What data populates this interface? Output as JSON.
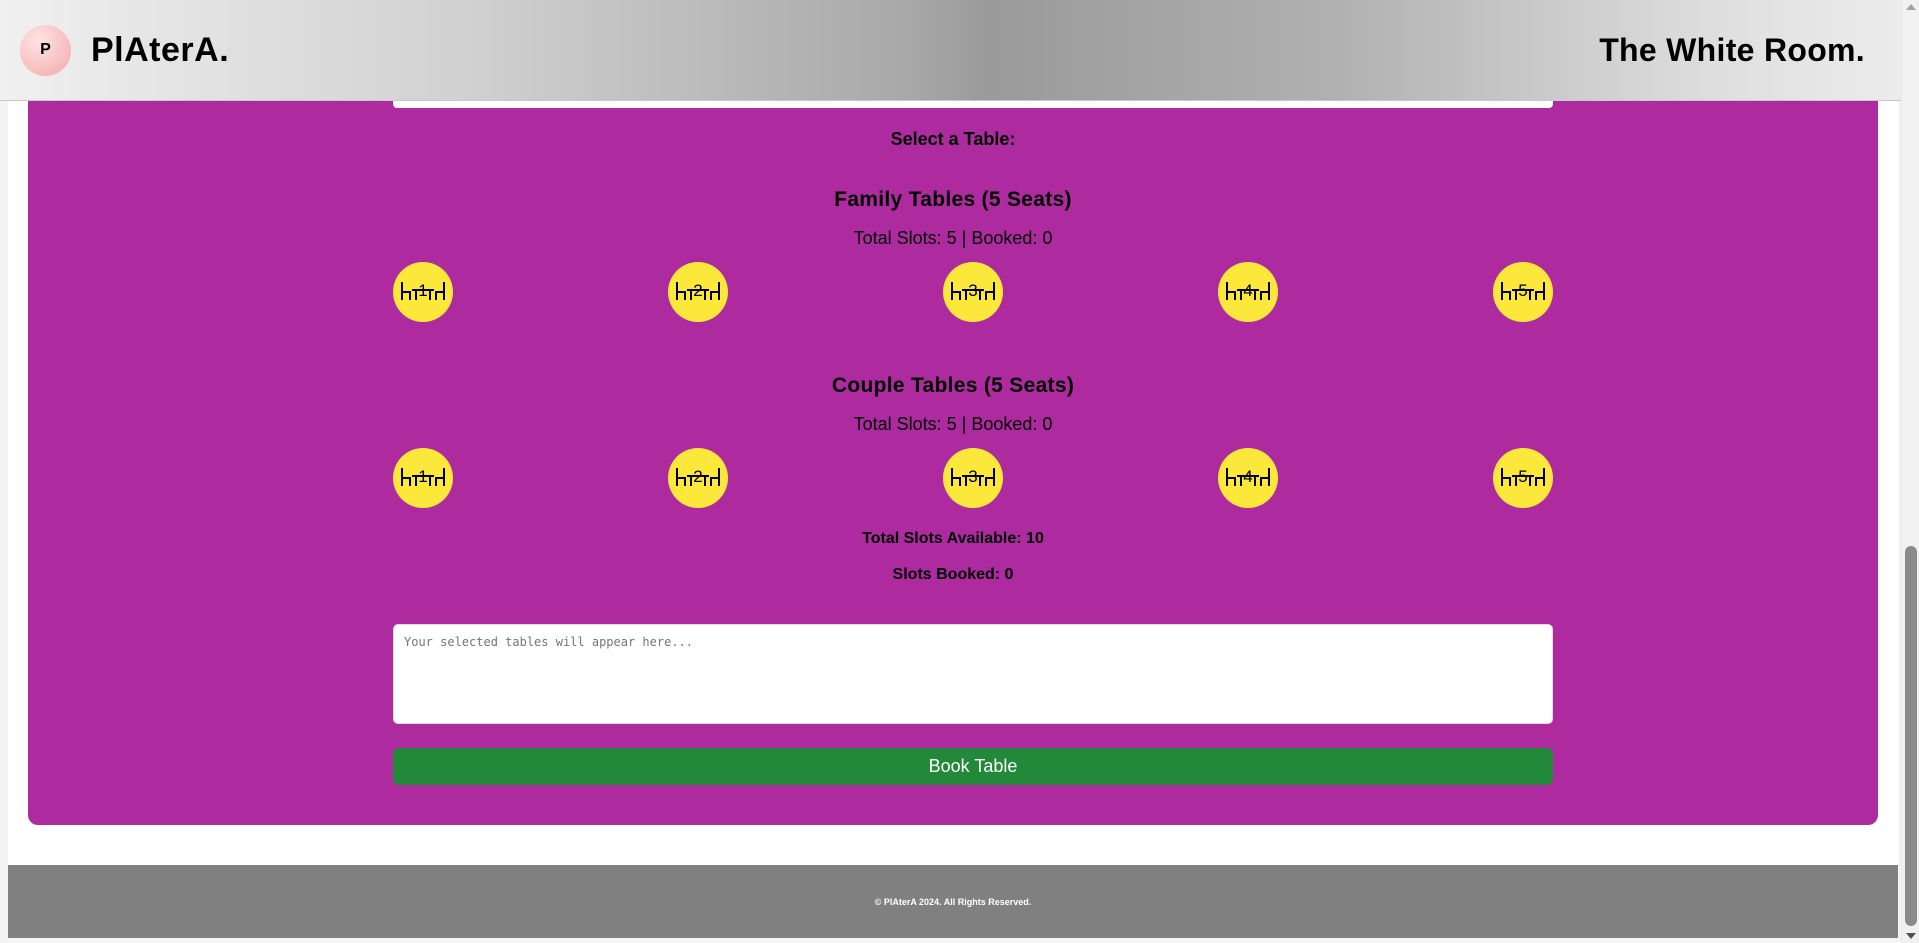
{
  "header": {
    "logo_letter": "P",
    "brand": "PlAterA.",
    "venue": "The White Room."
  },
  "booking": {
    "select_label": "Select a Table:",
    "family": {
      "title": "Family Tables (5 Seats)",
      "stats": "Total Slots: 5 | Booked: 0",
      "tables": [
        "1",
        "2",
        "3",
        "4",
        "5"
      ]
    },
    "couple": {
      "title": "Couple Tables (5 Seats)",
      "stats": "Total Slots: 5 | Booked: 0",
      "tables": [
        "1",
        "2",
        "3",
        "4",
        "5"
      ]
    },
    "total_available": "Total Slots Available: 10",
    "slots_booked": "Slots Booked: 0",
    "selected_placeholder": "Your selected tables will appear here...",
    "book_button": "Book Table"
  },
  "footer": {
    "text": "© PlAterA 2024. All Rights Reserved."
  },
  "colors": {
    "panel": "#ad2b9f",
    "table": "#fce83a",
    "book_button": "#22883a",
    "footer": "#808080"
  },
  "icons": {
    "table": "table-chairs-icon"
  }
}
